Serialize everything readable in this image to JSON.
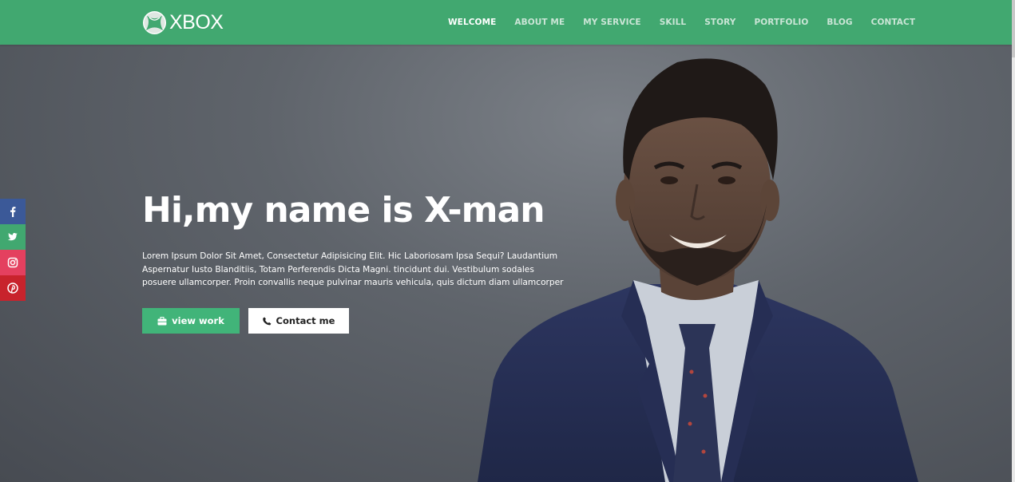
{
  "brand": {
    "name": "XBOX",
    "accent": "#41a870"
  },
  "nav": {
    "items": [
      "WELCOME",
      "ABOUT ME",
      "MY SERVICE",
      "SKILL",
      "STORY",
      "PORTFOLIO",
      "BLOG",
      "CONTACT"
    ],
    "active": "WELCOME"
  },
  "social": [
    "facebook-icon",
    "twitter-icon",
    "instagram-icon",
    "pinterest-icon"
  ],
  "hero": {
    "headline": "Hi,my name is X-man",
    "description": "Lorem Ipsum Dolor Sit Amet, Consectetur Adipisicing Elit. Hic Laboriosam Ipsa Sequi? Laudantium Aspernatur Iusto Blanditiis, Totam Perferendis Dicta Magni. tincidunt dui. Vestibulum sodales posuere ullamcorper. Proin convallis neque pulvinar mauris vehicula, quis dictum diam ullamcorper",
    "view_work_label": "view work",
    "contact_label": "Contact me"
  }
}
